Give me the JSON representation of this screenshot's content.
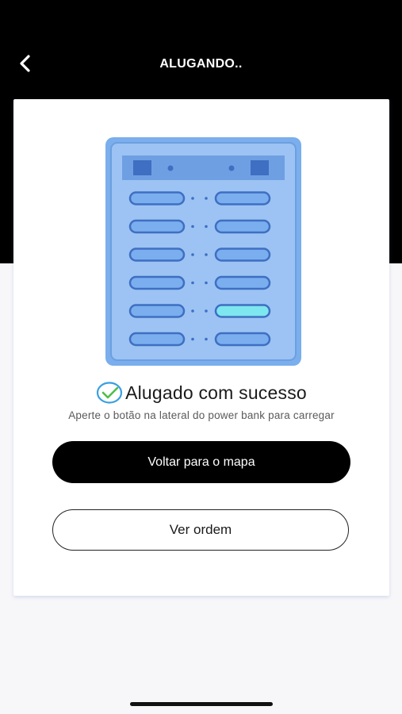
{
  "header": {
    "title": "ALUGANDO.."
  },
  "status": {
    "title": "Alugado com sucesso",
    "message": "Aperte o botão na lateral do power bank para carregar"
  },
  "actions": {
    "primary_label": "Voltar para o mapa",
    "secondary_label": "Ver ordem"
  },
  "icons": {
    "back": "chevron-left-icon",
    "success": "check-circle-icon",
    "illustration": "power-bank-station-illustration"
  },
  "colors": {
    "header_bg": "#000000",
    "page_bg": "#f7f7f9",
    "primary_button": "#000000",
    "check_circle": "#3aa0e0",
    "check_mark": "#4cc04a",
    "station_body": "#7fb2ee",
    "slot_active": "#7ee6ee"
  }
}
